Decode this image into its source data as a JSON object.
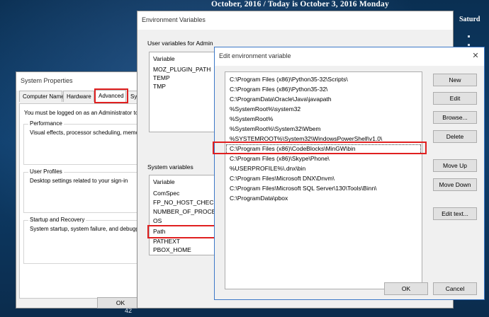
{
  "desktop": {
    "calendar_banner": "October, 2016 / Today is October 3, 2016 Monday",
    "calendar_day": "Saturd",
    "bottom_number": "42"
  },
  "system_properties": {
    "title": "System Properties",
    "tabs": [
      "Computer Name",
      "Hardware",
      "Advanced",
      "Sys"
    ],
    "active_tab": "Advanced",
    "admin_note": "You must be logged on as an Administrator to",
    "groups": [
      {
        "title": "Performance",
        "text": "Visual effects, processor scheduling, memor"
      },
      {
        "title": "User Profiles",
        "text": "Desktop settings related to your sign-in"
      },
      {
        "title": "Startup and Recovery",
        "text": "System startup, system failure, and debuggi"
      }
    ],
    "ok_label": "OK"
  },
  "environment_variables": {
    "title": "Environment Variables",
    "user_section_label": "User variables for Admin",
    "user_header": "Variable",
    "user_vars": [
      "MOZ_PLUGIN_PATH",
      "TEMP",
      "TMP"
    ],
    "system_section_label": "System variables",
    "system_header": "Variable",
    "system_vars": [
      "ComSpec",
      "FP_NO_HOST_CHECK",
      "NUMBER_OF_PROCESS",
      "OS",
      "Path",
      "PATHEXT",
      "PBOX_HOME"
    ],
    "highlighted_system_var": "Path"
  },
  "edit_env": {
    "title": "Edit environment variable",
    "entries": [
      "C:\\Program Files (x86)\\Python35-32\\Scripts\\",
      "C:\\Program Files (x86)\\Python35-32\\",
      "C:\\ProgramData\\Oracle\\Java\\javapath",
      "%SystemRoot%\\system32",
      "%SystemRoot%",
      "%SystemRoot%\\System32\\Wbem",
      "%SYSTEMROOT%\\System32\\WindowsPowerShell\\v1.0\\",
      "C:\\Program Files (x86)\\CodeBlocks\\MinGW\\bin",
      "C:\\Program Files (x86)\\Skype\\Phone\\",
      "%USERPROFILE%\\.dnx\\bin",
      "C:\\Program Files\\Microsoft DNX\\Dnvm\\",
      "C:\\Program Files\\Microsoft SQL Server\\130\\Tools\\Binn\\",
      "C:\\ProgramData\\pbox"
    ],
    "selected_entry": "C:\\Program Files (x86)\\CodeBlocks\\MinGW\\bin",
    "buttons": {
      "new": "New",
      "edit": "Edit",
      "browse": "Browse...",
      "delete": "Delete",
      "move_up": "Move Up",
      "move_down": "Move Down",
      "edit_text": "Edit text...",
      "ok": "OK",
      "cancel": "Cancel"
    },
    "highlight_color": "#e02020"
  }
}
